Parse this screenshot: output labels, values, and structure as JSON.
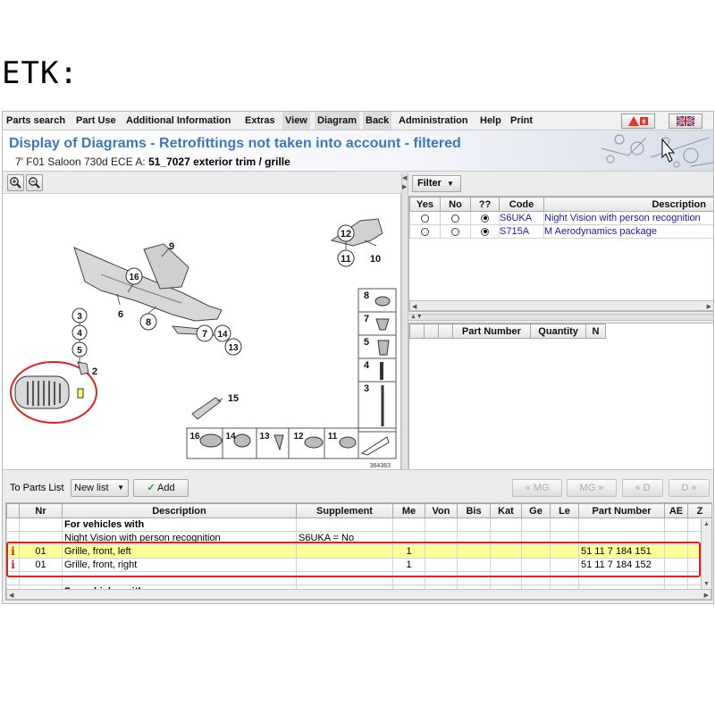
{
  "heading": "ETK:",
  "menu": [
    "Parts search",
    "Part Use",
    "Additional Information",
    "Extras",
    "View",
    "Diagram",
    "Back",
    "Administration",
    "Help",
    "Print"
  ],
  "title": {
    "main": "Display of Diagrams - Retrofittings not taken into account - filtered",
    "sub_prefix": "7' F01 Saloon 730d ECE  A: ",
    "sub_bold": "51_7027 exterior trim / grille"
  },
  "diagram": {
    "labels": [
      "12",
      "11",
      "10",
      "9",
      "16",
      "6",
      "8",
      "3",
      "4",
      "5",
      "2",
      "7",
      "14",
      "13",
      "15",
      "8",
      "7",
      "5",
      "4",
      "3",
      "16",
      "14",
      "13",
      "12",
      "11"
    ],
    "image_number": "364363"
  },
  "filter": {
    "button_label": "Filter",
    "columns": [
      "Yes",
      "No",
      "??",
      "Code",
      "Description"
    ],
    "rows": [
      {
        "code": "S6UKA",
        "description": "Night Vision with person recognition"
      },
      {
        "code": "S715A",
        "description": "M Aerodynamics package"
      }
    ]
  },
  "selection": {
    "columns": [
      "",
      "",
      "",
      "Part Number",
      "Quantity",
      "N"
    ]
  },
  "toolbar": {
    "to_parts_list": "To Parts List",
    "list_select": "New list",
    "add": "Add",
    "nav": [
      "« MG",
      "MG »",
      "« D",
      "D »"
    ]
  },
  "parts": {
    "columns": [
      "",
      "Nr",
      "Description",
      "Supplement",
      "Me",
      "Von",
      "Bis",
      "Kat",
      "Ge",
      "Le",
      "Part Number",
      "AE",
      "Z"
    ],
    "rows": [
      {
        "info": "",
        "nr": "",
        "desc": "For vehicles with",
        "supp": "",
        "me": "",
        "pn": "",
        "bold": true
      },
      {
        "info": "",
        "nr": "",
        "desc": "Night Vision with person recognition",
        "supp": "S6UKA = No",
        "me": "",
        "pn": ""
      },
      {
        "info": "i",
        "nr": "01",
        "desc": "Grille, front, left",
        "supp": "",
        "me": "1",
        "pn": "51 11 7 184 151",
        "hl": true
      },
      {
        "info": "i",
        "nr": "01",
        "desc": "Grille, front, right",
        "supp": "",
        "me": "1",
        "pn": "51 11 7 184 152"
      },
      {
        "info": "",
        "nr": "",
        "desc": "",
        "supp": "",
        "me": "",
        "pn": ""
      },
      {
        "info": "",
        "nr": "",
        "desc": "For vehicles with",
        "supp": "",
        "me": "",
        "pn": "",
        "bold": true
      }
    ]
  },
  "colors": {
    "title_blue": "#3e78b8",
    "highlight_yellow": "#ffff99",
    "annotation_red": "#e0231c",
    "link_blue": "#1a1aa8"
  }
}
